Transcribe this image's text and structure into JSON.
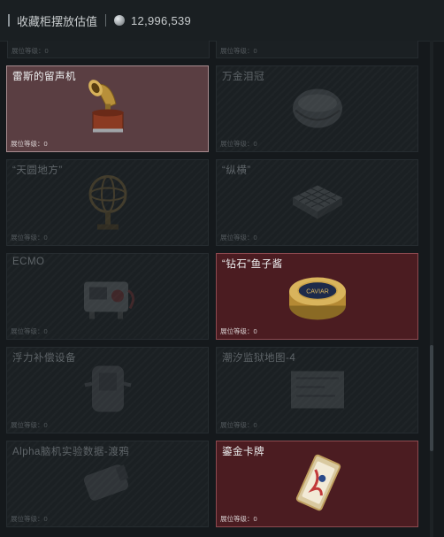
{
  "header": {
    "title": "收藏柜摆放估值",
    "value": "12,996,539",
    "coin_icon": "silver-coin-icon"
  },
  "level_label": "展位等级：",
  "partial_row": [
    {
      "level": "0"
    },
    {
      "level": "0"
    }
  ],
  "cards": [
    {
      "name": "雷斯的留声机",
      "level": "0",
      "state": "owned-pink",
      "icon": "gramophone-icon"
    },
    {
      "name": "万金泪冠",
      "level": "0",
      "state": "dim",
      "icon": "crown-icon"
    },
    {
      "name": "“天圆地方”",
      "level": "0",
      "state": "dim",
      "icon": "armillary-sphere-icon"
    },
    {
      "name": "“纵横”",
      "level": "0",
      "state": "dim",
      "icon": "chessboard-icon"
    },
    {
      "name": "ECMO",
      "level": "0",
      "state": "dim",
      "icon": "ecmo-machine-icon"
    },
    {
      "name": "“钻石”鱼子酱",
      "level": "0",
      "state": "owned-red",
      "icon": "caviar-tin-icon",
      "icon_text": "CAVIAR"
    },
    {
      "name": "浮力补偿设备",
      "level": "0",
      "state": "dim",
      "icon": "buoyancy-device-icon"
    },
    {
      "name": "潮汐监狱地图-4",
      "level": "0",
      "state": "dim",
      "icon": "map-icon"
    },
    {
      "name": "Alpha脑机实验数据-渡鸦",
      "level": "0",
      "state": "dim",
      "icon": "data-drive-icon"
    },
    {
      "name": "鎏金卡牌",
      "level": "0",
      "state": "owned-red",
      "icon": "gilded-card-icon"
    }
  ],
  "colors": {
    "background": "#15191c",
    "owned_pink": "#5a3e42",
    "owned_red": "#4b1c21"
  }
}
